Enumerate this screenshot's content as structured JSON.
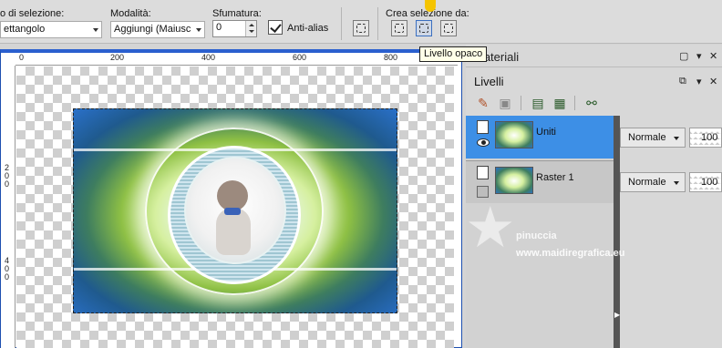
{
  "toolbar": {
    "selection_type_label": "o di selezione:",
    "selection_type_value": "ettangolo",
    "mode_label": "Modalità:",
    "mode_value": "Aggiungi (Maiusc",
    "feather_label": "Sfumatura:",
    "feather_value": "0",
    "antialias_label": "Anti-alias",
    "antialias_checked": true,
    "create_from_label": "Crea selezione da:",
    "tooltip": "Livello opaco"
  },
  "rulers": {
    "h_ticks": [
      "0",
      "200",
      "400",
      "600",
      "800"
    ],
    "v_ticks": [
      "200",
      "400"
    ]
  },
  "panels": {
    "materials_title": "Materiali",
    "layers_title": "Livelli"
  },
  "layers": [
    {
      "name": "Uniti",
      "blend": "Normale",
      "opacity": "100",
      "selected": true,
      "visible": true
    },
    {
      "name": "Raster 1",
      "blend": "Normale",
      "opacity": "100",
      "selected": false,
      "visible": false
    }
  ],
  "watermark": {
    "name": "pinuccia",
    "url": "www.maidiregrafica.eu"
  },
  "icons": {
    "window_restore": "window-restore-icon",
    "pin": "pin-icon",
    "close": "close-icon",
    "link": "link-icon"
  }
}
